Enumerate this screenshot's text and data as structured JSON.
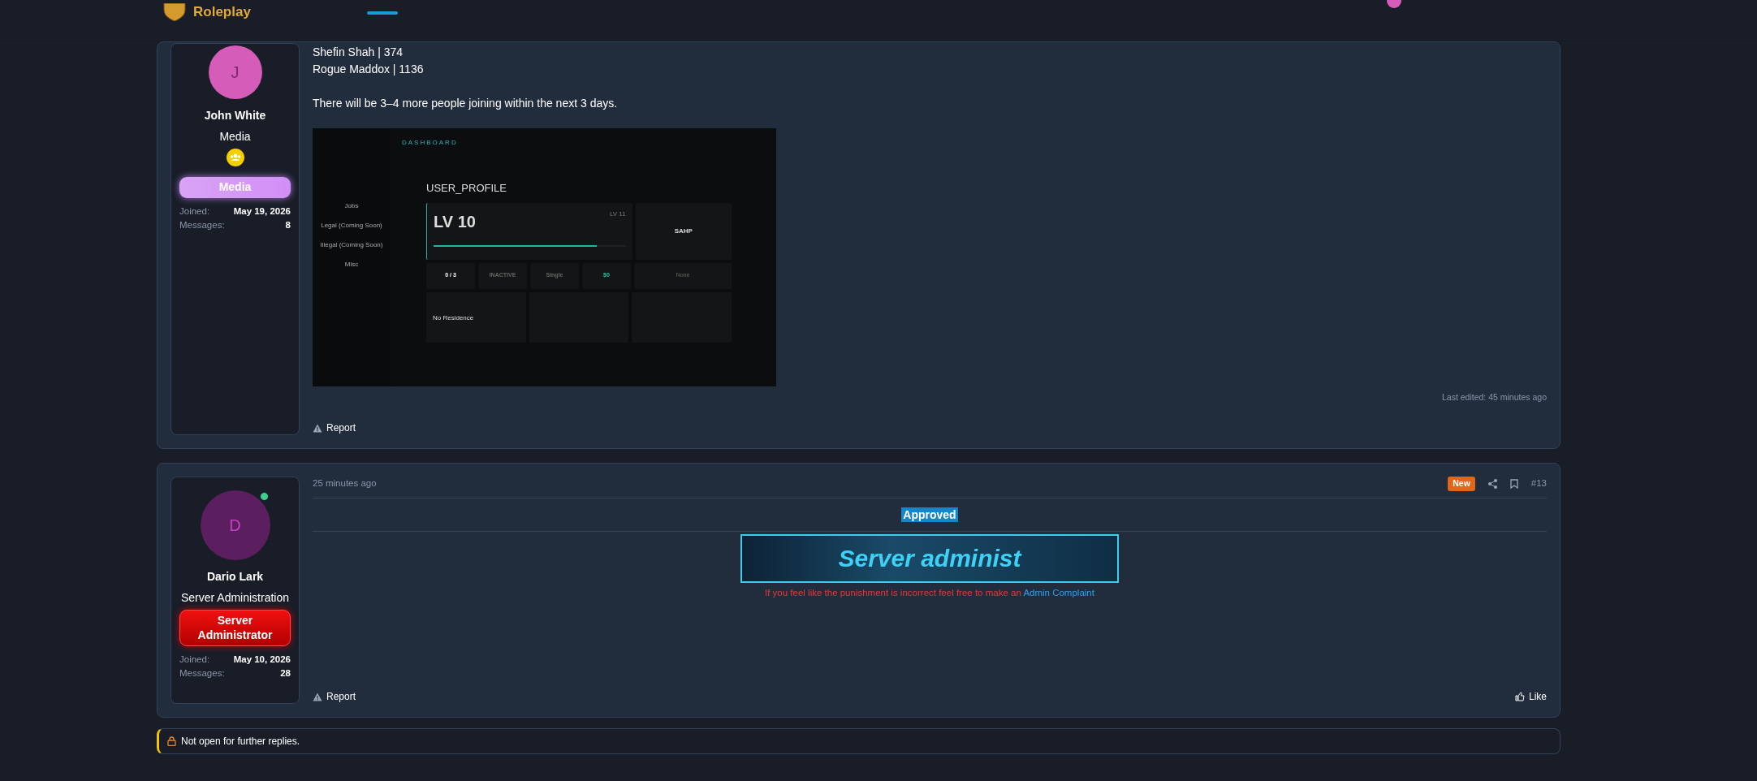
{
  "header": {
    "logo_text": "Roleplay"
  },
  "posts": [
    {
      "author": {
        "name": "John White",
        "title": "Media",
        "avatar_letter": "J",
        "color": "#d65cb9",
        "online": false,
        "trophy": true,
        "banner": {
          "text": "Media",
          "kind": "media"
        },
        "joined_label": "Joined:",
        "joined": "May 19, 2026",
        "messages_label": "Messages:",
        "messages": "8"
      },
      "body": [
        {
          "kind": "line",
          "text": "Shefin Shah | 374"
        },
        {
          "kind": "line",
          "text": "Rogue Maddox | 1136"
        },
        {
          "kind": "paragraph",
          "text": "There will be 3–4 more people joining within the next 3 days."
        },
        {
          "kind": "screenshot",
          "nav_title": "DASHBOARD",
          "sidebar": [
            "Jobs",
            "Legal (Coming Soon)",
            "Illegal (Coming Soon)",
            "Misc"
          ],
          "heading": "USER_PROFILE",
          "current_level": "LV 10",
          "next_level": "LV 11",
          "level": 0.85,
          "org": "SAHP",
          "stats": [
            "0 / 3",
            "INACTIVE",
            "Single",
            "$0"
          ],
          "status": "None",
          "residence": "No Residence"
        }
      ],
      "last_edited": "Last edited: 45 minutes ago",
      "report": "Report"
    },
    {
      "author": {
        "name": "Dario Lark",
        "title": "Server Administration",
        "avatar_letter": "D",
        "color": "#5b1e5e",
        "online": true,
        "trophy": false,
        "banner": {
          "text": "Server Administrator",
          "kind": "admin"
        },
        "joined_label": "Joined:",
        "joined": "May 10, 2026",
        "messages_label": "Messages:",
        "messages": "28"
      },
      "time": "25 minutes ago",
      "badge": "New",
      "number": "#13",
      "body": [
        {
          "kind": "highlight",
          "text": "Approved"
        },
        {
          "kind": "rule"
        },
        {
          "kind": "banner",
          "text": "Server administ"
        },
        {
          "kind": "notice",
          "text": "If you feel like the punishment is incorrect feel free to make an",
          "link": "Admin Complaint"
        }
      ],
      "report": "Report",
      "like": "Like"
    }
  ],
  "locked_notice": "Not open for further replies."
}
